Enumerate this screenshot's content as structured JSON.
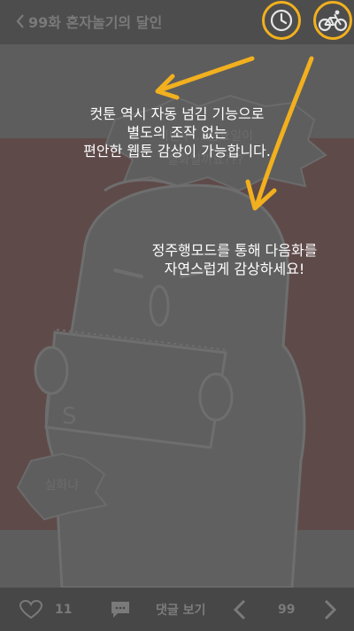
{
  "header": {
    "back_title": "99화 혼자놀기의 달인",
    "clock_icon": "clock-icon",
    "bicycle_icon": "bicycle-icon",
    "accent_color": "#f2b01e"
  },
  "comic": {
    "speech_top": "이번주... 금요일이\n실화일까요???",
    "speech_bottom": "실화냐",
    "sign_mark": "S"
  },
  "tutorial": {
    "text_auto": "컷툰 역시 자동 넘김 기능으로\n별도의 조작 없는\n편안한 웹툰 감상이 가능합니다.",
    "text_ride": "정주행모드를 통해 다음화를\n자연스럽게 감상하세요!"
  },
  "bottom": {
    "like_count": "11",
    "comment_label": "댓글 보기",
    "page_number": "99"
  }
}
